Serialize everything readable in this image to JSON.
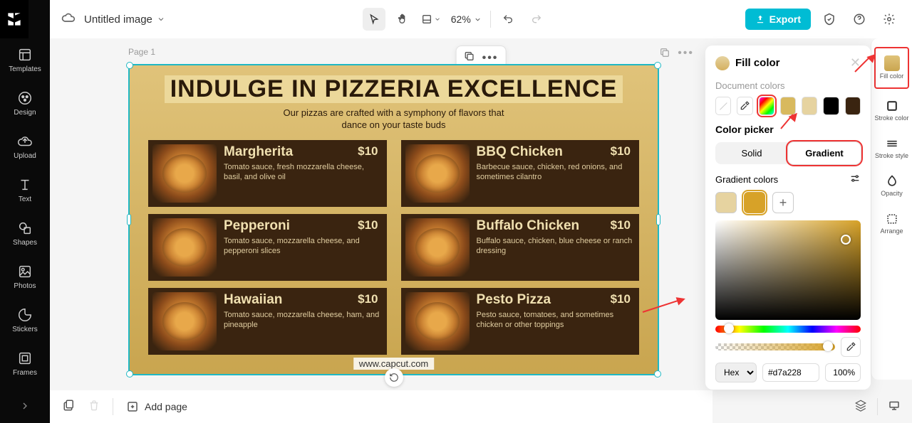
{
  "topbar": {
    "doc_title": "Untitled image",
    "zoom": "62%",
    "export": "Export"
  },
  "left_rail": [
    {
      "label": "Templates"
    },
    {
      "label": "Design"
    },
    {
      "label": "Upload"
    },
    {
      "label": "Text"
    },
    {
      "label": "Shapes"
    },
    {
      "label": "Photos"
    },
    {
      "label": "Stickers"
    },
    {
      "label": "Frames"
    }
  ],
  "canvas": {
    "page_label": "Page 1",
    "title": "INDULGE IN PIZZERIA EXCELLENCE",
    "subtitle": "Our pizzas are crafted with a symphony of flavors that\ndance on your taste buds",
    "watermark": "www.capcut.com",
    "items": [
      {
        "name": "Margherita",
        "price": "$10",
        "desc": "Tomato sauce, fresh mozzarella cheese, basil, and olive oil"
      },
      {
        "name": "BBQ Chicken",
        "price": "$10",
        "desc": "Barbecue sauce, chicken, red onions, and sometimes cilantro"
      },
      {
        "name": "Pepperoni",
        "price": "$10",
        "desc": "Tomato sauce, mozzarella cheese, and pepperoni slices"
      },
      {
        "name": "Buffalo Chicken",
        "price": "$10",
        "desc": "Buffalo sauce, chicken, blue cheese or ranch dressing"
      },
      {
        "name": "Hawaiian",
        "price": "$10",
        "desc": "Tomato sauce, mozzarella cheese, ham, and pineapple"
      },
      {
        "name": "Pesto Pizza",
        "price": "$10",
        "desc": "Pesto sauce, tomatoes, and sometimes chicken or other toppings"
      }
    ]
  },
  "bottom": {
    "add_page": "Add page"
  },
  "prop_rail": [
    {
      "label": "Fill color"
    },
    {
      "label": "Stroke color"
    },
    {
      "label": "Stroke style"
    },
    {
      "label": "Opacity"
    },
    {
      "label": "Arrange"
    }
  ],
  "fill_panel": {
    "title": "Fill color",
    "doc_colors_label": "Document colors",
    "doc_colors": [
      "#d8b95e",
      "#e6d3a0",
      "#000000",
      "#3a2410"
    ],
    "color_picker_label": "Color picker",
    "tab_solid": "Solid",
    "tab_gradient": "Gradient",
    "grad_label": "Gradient colors",
    "grad_stops": [
      "#e6d3a0",
      "#d7a228"
    ],
    "hex_mode": "Hex",
    "hex_value": "#d7a228",
    "opacity": "100%"
  }
}
